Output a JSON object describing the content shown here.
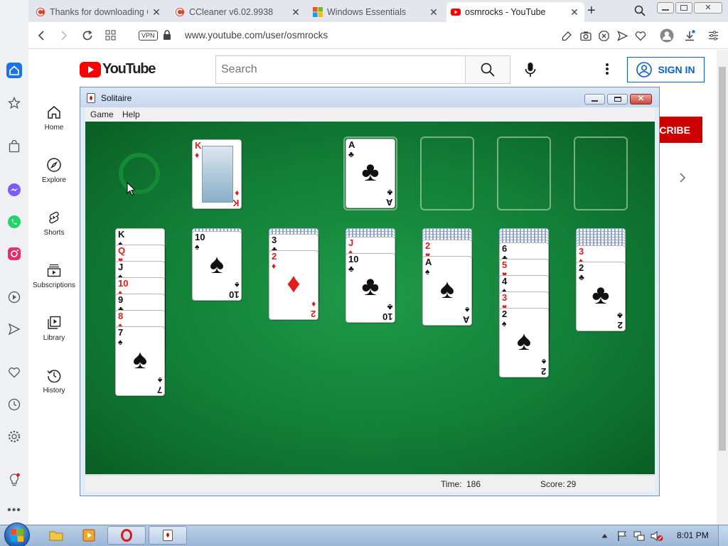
{
  "browser": {
    "tabs": [
      {
        "label": "Thanks for downloading C",
        "favicon": "ccleaner-icon",
        "active": false
      },
      {
        "label": "CCleaner v6.02.9938",
        "favicon": "ccleaner-icon",
        "active": false
      },
      {
        "label": "Windows Essentials",
        "favicon": "windows-icon",
        "active": false
      },
      {
        "label": "osmrocks - YouTube",
        "favicon": "youtube-icon",
        "active": true
      }
    ],
    "new_tab": "+",
    "address": "www.youtube.com/user/osmrocks",
    "vpn_badge": "VPN"
  },
  "youtube": {
    "logo_text": "YouTube",
    "search_placeholder": "Search",
    "sign_in": "SIGN IN",
    "subscribe_partial": "SCRIBE",
    "nav": [
      {
        "label": "Home",
        "icon": "home-icon"
      },
      {
        "label": "Explore",
        "icon": "compass-icon"
      },
      {
        "label": "Shorts",
        "icon": "shorts-icon"
      },
      {
        "label": "Subscriptions",
        "icon": "subscriptions-icon"
      },
      {
        "label": "Library",
        "icon": "library-icon"
      },
      {
        "label": "History",
        "icon": "history-icon"
      }
    ]
  },
  "solitaire": {
    "title": "Solitaire",
    "menu": [
      "Game",
      "Help"
    ],
    "status": {
      "time_label": "Time:",
      "time_value": "186",
      "score_label": "Score:",
      "score_value": "29"
    },
    "waste": {
      "rank": "K",
      "suit": "diamonds"
    },
    "foundations": [
      {
        "rank": "A",
        "suit": "clubs"
      },
      null,
      null,
      null
    ],
    "tableau": [
      {
        "hidden": 0,
        "up": [
          {
            "rank": "K",
            "suit": "spades"
          },
          {
            "rank": "Q",
            "suit": "hearts"
          },
          {
            "rank": "J",
            "suit": "spades"
          },
          {
            "rank": "10",
            "suit": "diamonds"
          },
          {
            "rank": "9",
            "suit": "clubs"
          },
          {
            "rank": "8",
            "suit": "diamonds"
          },
          {
            "rank": "7",
            "suit": "spades"
          }
        ]
      },
      {
        "hidden": 1,
        "up": [
          {
            "rank": "10",
            "suit": "spades"
          }
        ]
      },
      {
        "hidden": 2,
        "up": [
          {
            "rank": "3",
            "suit": "clubs"
          },
          {
            "rank": "2",
            "suit": "diamonds"
          }
        ]
      },
      {
        "hidden": 3,
        "up": [
          {
            "rank": "J",
            "suit": "diamonds"
          },
          {
            "rank": "10",
            "suit": "clubs"
          }
        ]
      },
      {
        "hidden": 4,
        "up": [
          {
            "rank": "2",
            "suit": "hearts"
          },
          {
            "rank": "A",
            "suit": "spades"
          }
        ]
      },
      {
        "hidden": 5,
        "up": [
          {
            "rank": "6",
            "suit": "clubs"
          },
          {
            "rank": "5",
            "suit": "hearts"
          },
          {
            "rank": "4",
            "suit": "spades"
          },
          {
            "rank": "3",
            "suit": "hearts"
          },
          {
            "rank": "2",
            "suit": "spades"
          }
        ]
      },
      {
        "hidden": 6,
        "up": [
          {
            "rank": "3",
            "suit": "diamonds"
          },
          {
            "rank": "2",
            "suit": "clubs"
          }
        ]
      }
    ]
  },
  "taskbar": {
    "clock": "8:01 PM"
  },
  "colors": {
    "youtube_red": "#ff0000",
    "felt": "#127e37",
    "subscribe": "#cc0000",
    "signin_blue": "#065fd4"
  }
}
